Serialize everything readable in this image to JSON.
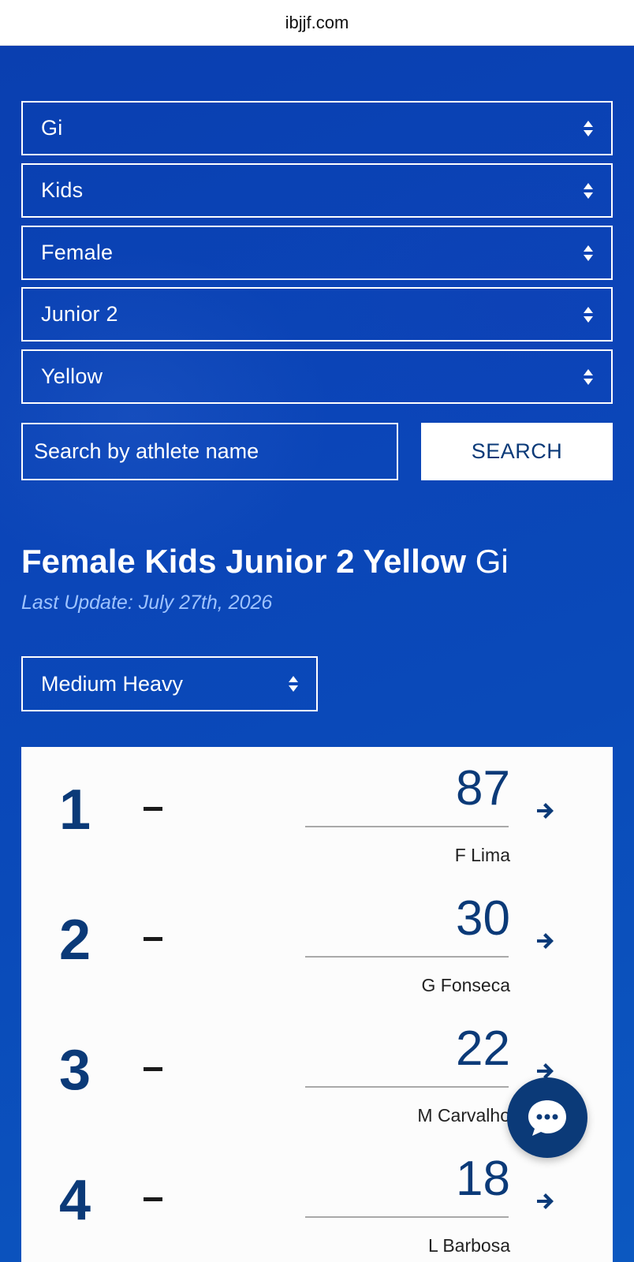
{
  "browser": {
    "url": "ibjjf.com"
  },
  "filters": {
    "uniform": "Gi",
    "age_group": "Kids",
    "gender": "Female",
    "division": "Junior 2",
    "belt": "Yellow"
  },
  "search": {
    "placeholder": "Search by athlete name",
    "button_label": "SEARCH"
  },
  "ranking": {
    "title_bold": "Female Kids Junior 2 Yellow",
    "title_light": "Gi",
    "last_update": "Last Update: July 27th, 2026",
    "weight_class": "Medium Heavy",
    "rows": [
      {
        "rank": "1",
        "change": "–",
        "points": "87",
        "athlete": "F Lima"
      },
      {
        "rank": "2",
        "change": "–",
        "points": "30",
        "athlete": "G Fonseca"
      },
      {
        "rank": "3",
        "change": "–",
        "points": "22",
        "athlete": "M Carvalho"
      },
      {
        "rank": "4",
        "change": "–",
        "points": "18",
        "athlete": "L Barbosa"
      }
    ]
  },
  "icons": {
    "select_caret": "up-down-caret-icon",
    "row_arrow": "arrow-right-icon",
    "chat": "chat-bubble-icon"
  },
  "colors": {
    "brand_blue": "#0b3a78",
    "hero_blue": "#0a45b6",
    "update_text": "#9ec3ff"
  }
}
